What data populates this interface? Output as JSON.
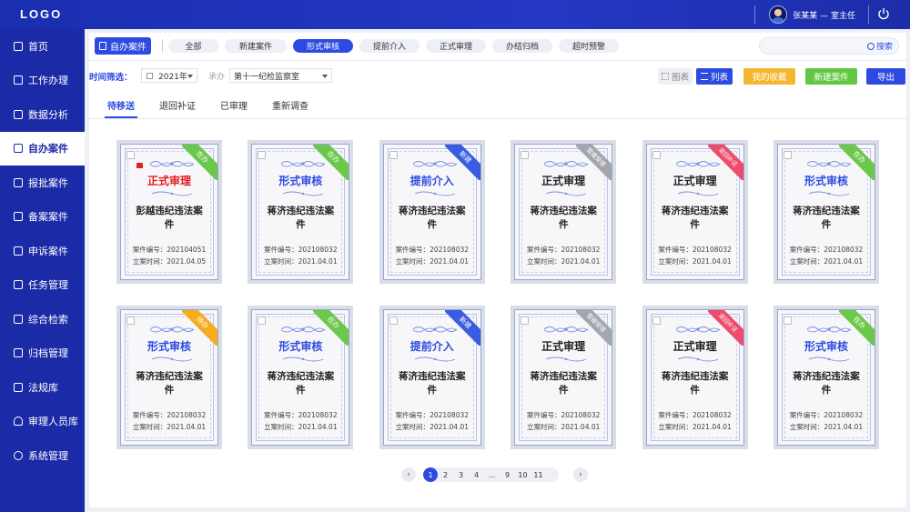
{
  "header": {
    "logo": "LOGO",
    "user_label": "张某某 — 室主任"
  },
  "sidebar": {
    "items": [
      {
        "label": "首页",
        "icon": "home-icon",
        "active": false
      },
      {
        "label": "工作办理",
        "icon": "briefcase-icon",
        "active": false
      },
      {
        "label": "数据分析",
        "icon": "chart-icon",
        "active": false
      },
      {
        "label": "自办案件",
        "icon": "clipboard-icon",
        "active": true
      },
      {
        "label": "报批案件",
        "icon": "document-icon",
        "active": false
      },
      {
        "label": "备案案件",
        "icon": "archive-icon",
        "active": false
      },
      {
        "label": "申诉案件",
        "icon": "message-icon",
        "active": false
      },
      {
        "label": "任务管理",
        "icon": "task-icon",
        "active": false
      },
      {
        "label": "综合检索",
        "icon": "grid-search-icon",
        "active": false
      },
      {
        "label": "归档管理",
        "icon": "folder-icon",
        "active": false
      },
      {
        "label": "法规库",
        "icon": "scale-icon",
        "active": false
      },
      {
        "label": "审理人员库",
        "icon": "users-icon",
        "active": false
      },
      {
        "label": "系统管理",
        "icon": "gear-icon",
        "active": false
      }
    ]
  },
  "toolbar": {
    "section_tag": "自办案件",
    "filters": [
      "全部",
      "新建案件",
      "形式审核",
      "提前介入",
      "正式审理",
      "办结归档",
      "超时预警"
    ],
    "active_filter": 2,
    "search_label": "搜索",
    "search_placeholder": ""
  },
  "time_filter": {
    "label": "时间筛选：",
    "year": "2021年",
    "undertaker_label": "承办",
    "undertaker_value": "第十一纪检监察室"
  },
  "view": {
    "tile_label": "图表",
    "list_label": "列表",
    "favorites_label": "我的收藏",
    "new_case_label": "新建案件",
    "export_label": "导出"
  },
  "tabs": [
    "待移送",
    "退回补证",
    "已审理",
    "重新调查"
  ],
  "active_tab": 0,
  "colors": {
    "primary": "#2d4be0",
    "sidebar": "#1b2aa6",
    "favorites": "#f5b731",
    "new_case": "#62c843",
    "export": "#2d4be0",
    "red_title": "#e11d1d"
  },
  "meta_labels": {
    "case_no": "案件编号：",
    "filed": "立案时间："
  },
  "cards": [
    {
      "stage": "正式审理",
      "stage_color": "#e11d1d",
      "name": "彭越违纪违法案件",
      "case_no": "202104051",
      "filed": "2021.04.05",
      "ribbon": "在办",
      "ribbon_color": "#6cc84a",
      "seal": true
    },
    {
      "stage": "形式审核",
      "stage_color": "#2d4be0",
      "name": "蒋济违纪违法案件",
      "case_no": "202108032",
      "filed": "2021.04.01",
      "ribbon": "在办",
      "ribbon_color": "#6cc84a",
      "seal": false
    },
    {
      "stage": "提前介入",
      "stage_color": "#2d4be0",
      "name": "蒋济违纪违法案件",
      "case_no": "202108032",
      "filed": "2021.04.01",
      "ribbon": "新建",
      "ribbon_color": "#3a5ce0",
      "seal": false
    },
    {
      "stage": "正式审理",
      "stage_color": "#222222",
      "name": "蒋济违纪违法案件",
      "case_no": "202108032",
      "filed": "2021.04.01",
      "ribbon": "暂缓受理",
      "ribbon_color": "#a4a6ad",
      "seal": false
    },
    {
      "stage": "正式审理",
      "stage_color": "#222222",
      "name": "蒋济违纪违法案件",
      "case_no": "202108032",
      "filed": "2021.04.01",
      "ribbon": "退回补证",
      "ribbon_color": "#ec4d6a",
      "seal": false
    },
    {
      "stage": "形式审核",
      "stage_color": "#2d4be0",
      "name": "蒋济违纪违法案件",
      "case_no": "202108032",
      "filed": "2021.04.01",
      "ribbon": "在办",
      "ribbon_color": "#6cc84a",
      "seal": false
    },
    {
      "stage": "形式审核",
      "stage_color": "#2d4be0",
      "name": "蒋济违纪违法案件",
      "case_no": "202108032",
      "filed": "2021.04.01",
      "ribbon": "待办",
      "ribbon_color": "#f5ad1f",
      "seal": false
    },
    {
      "stage": "形式审核",
      "stage_color": "#2d4be0",
      "name": "蒋济违纪违法案件",
      "case_no": "202108032",
      "filed": "2021.04.01",
      "ribbon": "在办",
      "ribbon_color": "#6cc84a",
      "seal": false
    },
    {
      "stage": "提前介入",
      "stage_color": "#2d4be0",
      "name": "蒋济违纪违法案件",
      "case_no": "202108032",
      "filed": "2021.04.01",
      "ribbon": "新建",
      "ribbon_color": "#3a5ce0",
      "seal": false
    },
    {
      "stage": "正式审理",
      "stage_color": "#222222",
      "name": "蒋济违纪违法案件",
      "case_no": "202108032",
      "filed": "2021.04.01",
      "ribbon": "暂缓受理",
      "ribbon_color": "#a4a6ad",
      "seal": false
    },
    {
      "stage": "正式审理",
      "stage_color": "#222222",
      "name": "蒋济违纪违法案件",
      "case_no": "202108032",
      "filed": "2021.04.01",
      "ribbon": "退回补证",
      "ribbon_color": "#ec4d6a",
      "seal": false
    },
    {
      "stage": "形式审核",
      "stage_color": "#2d4be0",
      "name": "蒋济违纪违法案件",
      "case_no": "202108032",
      "filed": "2021.04.01",
      "ribbon": "在办",
      "ribbon_color": "#6cc84a",
      "seal": false
    }
  ],
  "pagination": {
    "pages": [
      "1",
      "2",
      "3",
      "4",
      "...",
      "9",
      "10",
      "11"
    ],
    "current": "1",
    "prev": "‹",
    "next": "›"
  }
}
